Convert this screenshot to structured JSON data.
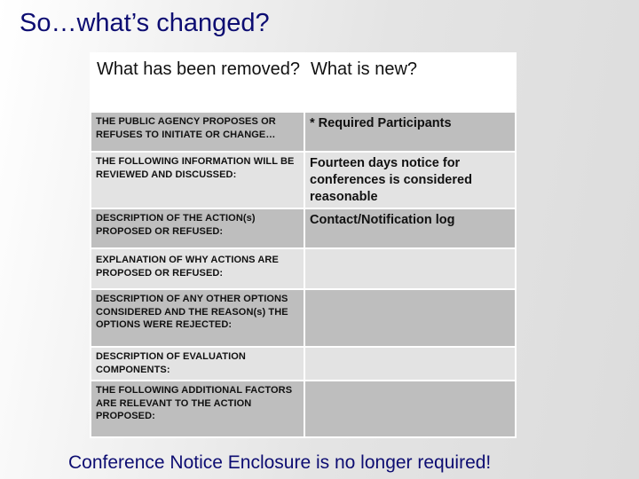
{
  "slide": {
    "title": "So…what’s changed?",
    "footer": "Conference Notice Enclosure is no longer required!"
  },
  "table": {
    "headers": {
      "removed": "What has  been removed?",
      "new": "What is new?"
    },
    "rows": [
      {
        "removed": "THE PUBLIC AGENCY PROPOSES OR REFUSES TO INITIATE OR CHANGE…",
        "new": "* Required Participants"
      },
      {
        "removed": "THE FOLLOWING INFORMATION WILL BE REVIEWED AND DISCUSSED:",
        "new": "Fourteen days notice for conferences is considered reasonable"
      },
      {
        "removed": "DESCRIPTION OF THE ACTION(s) PROPOSED OR REFUSED:",
        "new": "Contact/Notification log"
      },
      {
        "removed": "EXPLANATION OF WHY ACTIONS ARE PROPOSED OR REFUSED:",
        "new": ""
      },
      {
        "removed": "DESCRIPTION OF ANY OTHER OPTIONS CONSIDERED AND THE REASON(s) THE OPTIONS WERE REJECTED:",
        "new": ""
      },
      {
        "removed": "DESCRIPTION OF EVALUATION COMPONENTS:",
        "new": ""
      },
      {
        "removed": "THE FOLLOWING ADDITIONAL FACTORS ARE RELEVANT TO THE ACTION PROPOSED:",
        "new": ""
      }
    ]
  },
  "colors": {
    "title_text": "#0d0d72",
    "row_dark": "#bebebe",
    "row_light": "#e3e3e3"
  }
}
